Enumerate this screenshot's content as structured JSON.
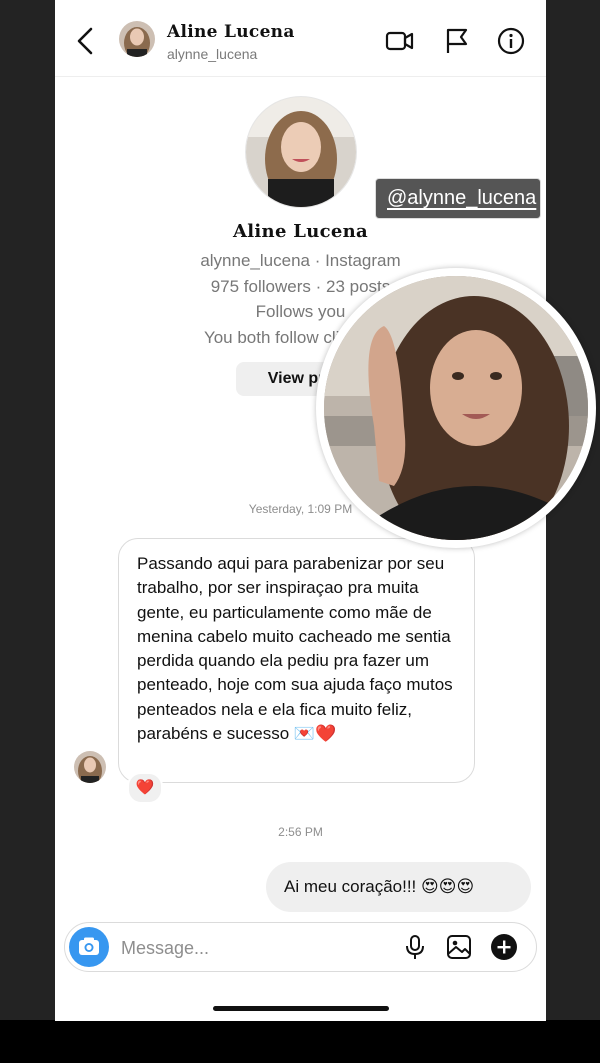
{
  "header": {
    "name": "Aline Lucena",
    "handle": "alynne_lucena",
    "icons": [
      "back-chevron-icon",
      "video-call-icon",
      "flag-icon",
      "info-icon"
    ]
  },
  "profile": {
    "name": "Aline Lucena",
    "line1": "alynne_lucena · Instagram",
    "line2": "975 followers · 23 posts",
    "line3": "Follows you",
    "line4": "You both follow clinicasey",
    "button": "View pro"
  },
  "messages": {
    "time1": "Yesterday, 1:09 PM",
    "incoming_text": "Passando aqui para parabenizar por seu trabalho, por ser inspiraçao pra muita gente,  eu particulamente como mãe de menina cabelo muito cacheado me sentia perdida quando ela pediu pra fazer um penteado, hoje com sua ajuda faço mutos penteados nela e ela fica muito feliz, parabéns e sucesso 💌❤️",
    "reaction": "❤️",
    "time2": "2:56 PM",
    "outgoing_text": "Ai meu coração!!! 😍😍😍"
  },
  "composer": {
    "placeholder": "Message...",
    "icons": [
      "camera-icon",
      "microphone-icon",
      "gallery-icon",
      "add-icon"
    ]
  },
  "overlay": {
    "tag": "@alynne_lucena"
  },
  "colors": {
    "accent": "#3797f0",
    "bubble_out": "#efefef",
    "heart": "#e0243a",
    "backdrop": "#232323"
  }
}
